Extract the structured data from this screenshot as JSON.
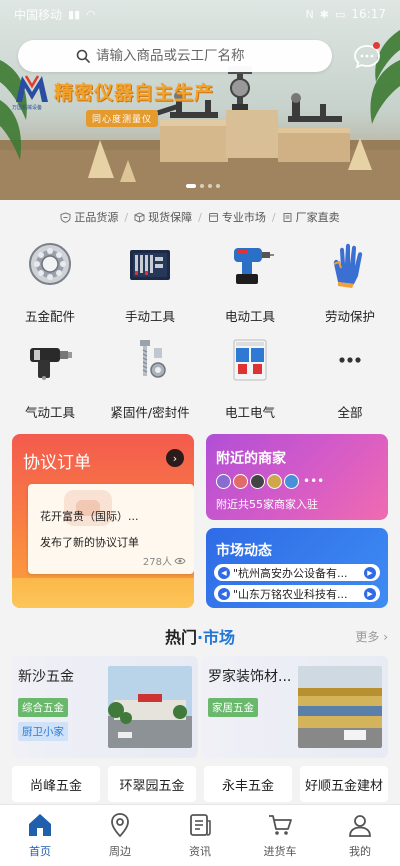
{
  "status_bar": {
    "carrier": "中国移动",
    "time": "16:17"
  },
  "search": {
    "placeholder": "请输入商品或云工厂名称"
  },
  "banner": {
    "slogan": "精密仪器自主生产",
    "sub_slogan": "同心度测量仪",
    "logo_text": "JM",
    "logo_sub": "万国机械设备",
    "page_count": 4,
    "active_page": 1
  },
  "features": [
    "正品货源",
    "现货保障",
    "专业市场",
    "厂家直卖"
  ],
  "categories": [
    {
      "label": "五金配件",
      "icon": "bearing-icon"
    },
    {
      "label": "手动工具",
      "icon": "toolbox-icon"
    },
    {
      "label": "电动工具",
      "icon": "drill-icon"
    },
    {
      "label": "劳动保护",
      "icon": "glove-icon"
    },
    {
      "label": "气动工具",
      "icon": "pneumatic-wrench-icon"
    },
    {
      "label": "紧固件/密封件",
      "icon": "bolt-icon"
    },
    {
      "label": "电工电气",
      "icon": "circuit-breaker-icon"
    },
    {
      "label": "全部",
      "icon": "more-icon"
    }
  ],
  "order_card": {
    "title": "协议订单",
    "line1": "花开富贵（国际）...",
    "line2": "发布了新的协议订单",
    "count": "278人"
  },
  "nearby_card": {
    "title": "附近的商家",
    "subtitle": "附近共55家商家入驻"
  },
  "market_card": {
    "title": "市场动态",
    "news": [
      "\"杭州高安办公设备有...",
      "\"山东万铭农业科技有..."
    ]
  },
  "hot_market": {
    "title_prefix": "热门",
    "title_dot": "·",
    "title_suffix": "市场",
    "more": "更多 ›",
    "markets": [
      {
        "name": "新沙五金",
        "tags": [
          "综合五金",
          "厨卫小家"
        ]
      },
      {
        "name": "罗家装饰材...",
        "tags": [
          "家居五金"
        ]
      }
    ],
    "shops": [
      "尚峰五金",
      "环翠园五金",
      "永丰五金",
      "好顺五金建材"
    ]
  },
  "tabs": [
    {
      "label": "首页",
      "icon": "home-icon",
      "active": true
    },
    {
      "label": "周边",
      "icon": "location-pin-icon",
      "active": false
    },
    {
      "label": "资讯",
      "icon": "news-icon",
      "active": false
    },
    {
      "label": "进货车",
      "icon": "cart-icon",
      "active": false
    },
    {
      "label": "我的",
      "icon": "user-icon",
      "active": false
    }
  ],
  "colors": {
    "primary": "#1f5fae",
    "order_red": "#f35a4e",
    "nearby_purple": "#b14fd6",
    "market_blue": "#2f6be6",
    "tag_green": "#69b86c"
  }
}
